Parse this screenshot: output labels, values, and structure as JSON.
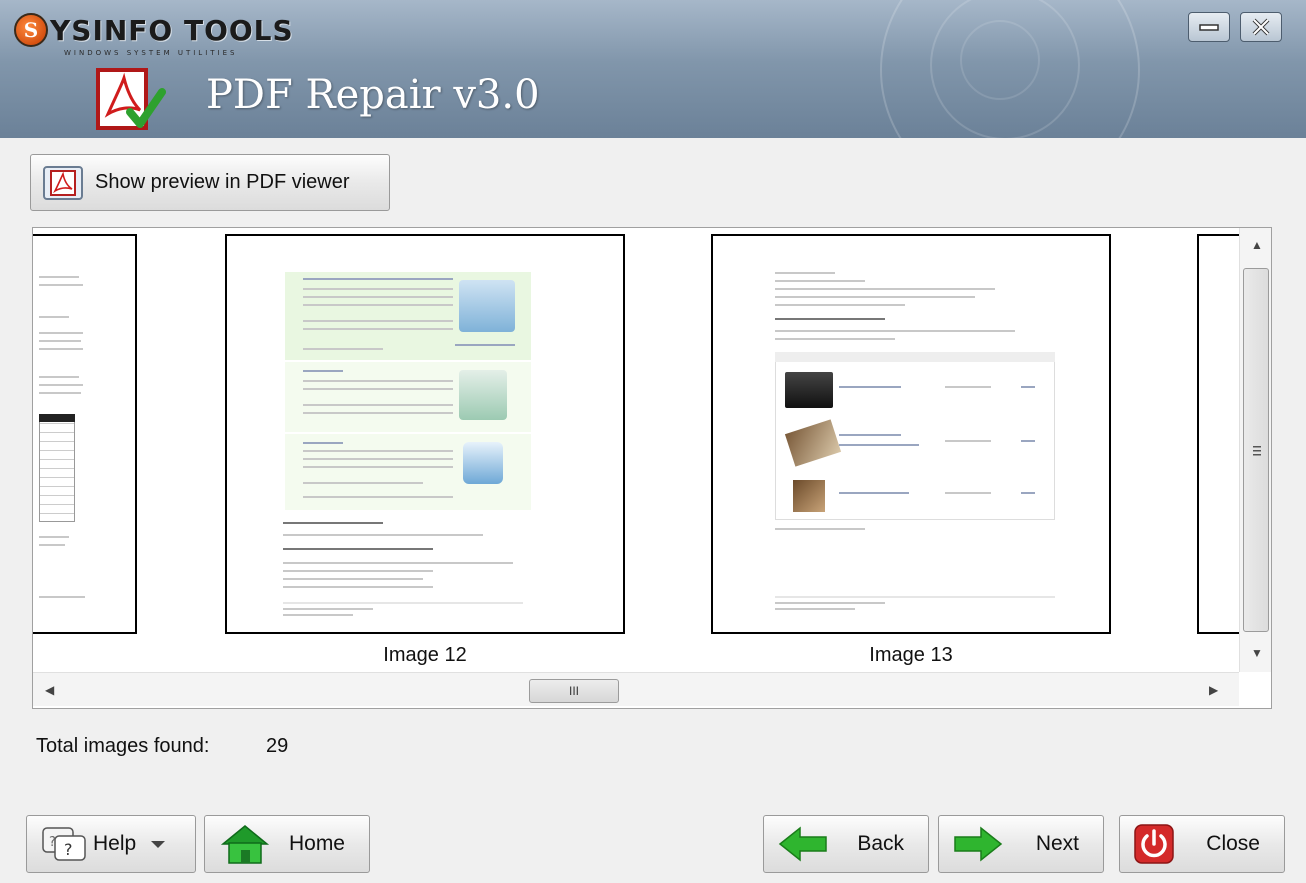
{
  "header": {
    "brand_letter": "S",
    "brand_name": "YSINFO TOOLS",
    "brand_tagline": "WINDOWS SYSTEM UTILITIES",
    "app_title": "PDF Repair v3.0"
  },
  "toolbar": {
    "preview_label": "Show preview in PDF viewer"
  },
  "preview": {
    "images": [
      {
        "caption": "Image 12"
      },
      {
        "caption": "Image 13"
      }
    ],
    "hscroll_thumb_grip": "III"
  },
  "status": {
    "total_label": "Total images found:",
    "total_value": "29"
  },
  "buttons": {
    "help": "Help",
    "home": "Home",
    "back": "Back",
    "next": "Next",
    "close": "Close"
  },
  "colors": {
    "header_top": "#a6b7c9",
    "header_bottom": "#6b8198",
    "arrow_green": "#2fb52f",
    "close_red": "#d42a2a"
  },
  "icons": [
    "pdf-icon",
    "minimize-icon",
    "close-window-icon",
    "help-icon",
    "home-icon",
    "back-arrow-icon",
    "next-arrow-icon",
    "power-icon"
  ]
}
